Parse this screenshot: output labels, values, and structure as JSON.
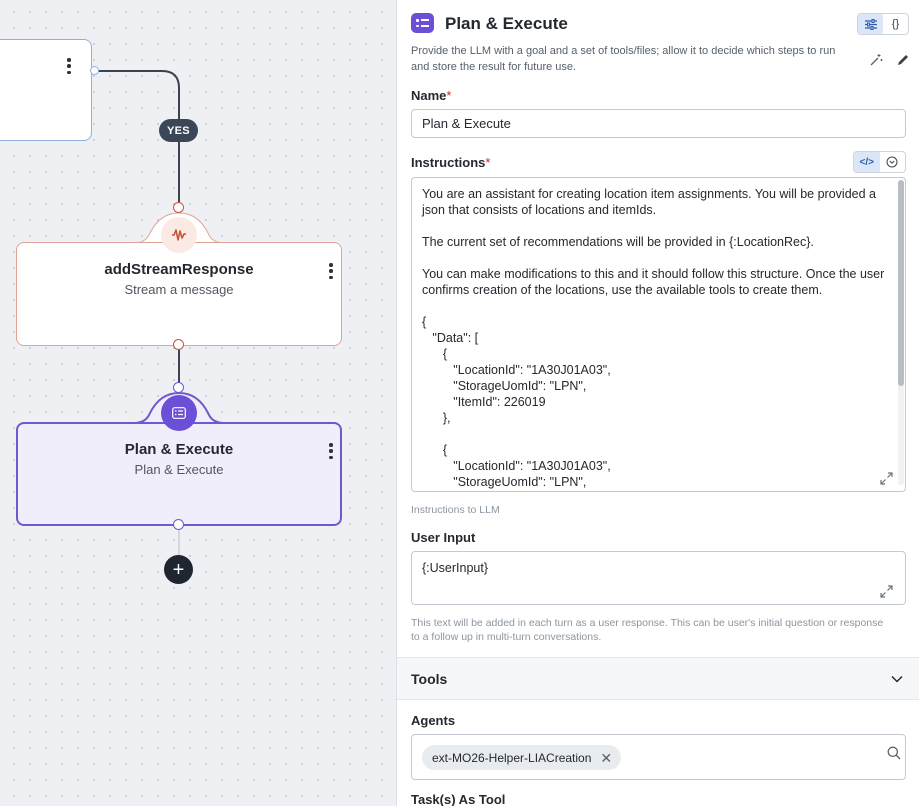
{
  "canvas": {
    "yes_badge": "YES",
    "nodes": [
      {
        "id": "stream",
        "title": "addStreamResponse",
        "subtitle": "Stream a message",
        "icon": "waveform-icon",
        "accent": "#c8553d"
      },
      {
        "id": "plan",
        "title": "Plan & Execute",
        "subtitle": "Plan & Execute",
        "icon": "plan-execute-icon",
        "accent": "#6e59d1"
      }
    ],
    "add_button": "+"
  },
  "panel": {
    "title": "Plan & Execute",
    "icon": "plan-execute-icon",
    "accent": "#6b4fd6",
    "view_toggle": {
      "form_icon": "sliders-icon",
      "json_label": "{}"
    },
    "description": "Provide the LLM with a goal and a set of tools/files; allow it to decide which steps to run and store the result for future use.",
    "name_field": {
      "label": "Name",
      "required_mark": "*",
      "value": "Plan & Execute"
    },
    "instructions": {
      "label": "Instructions",
      "required_mark": "*",
      "code_toggle": "</>",
      "value": "You are an assistant for creating location item assignments. You will be provided a json that consists of locations and itemIds.\n\nThe current set of recommendations will be provided in {:LocationRec}.\n\nYou can make modifications to this and it should follow this structure. Once the user confirms creation of the locations, use the available tools to create them.\n\n{\n   \"Data\": [\n      {\n         \"LocationId\": \"1A30J01A03\",\n         \"StorageUomId\": \"LPN\",\n         \"ItemId\": 226019\n      },\n\n      {\n         \"LocationId\": \"1A30J01A03\",\n         \"StorageUomId\": \"LPN\",",
      "hint": "Instructions to LLM"
    },
    "user_input": {
      "label": "User Input",
      "value": "{:UserInput}",
      "hint": "This text will be added in each turn as a user response. This can be user's initial question or response to a follow up in multi-turn conversations."
    },
    "tools": {
      "title": "Tools"
    },
    "agents": {
      "label": "Agents",
      "chips": [
        "ext-MO26-Helper-LIACreation"
      ]
    },
    "task_as_tool": {
      "label": "Task(s) As Tool"
    }
  }
}
